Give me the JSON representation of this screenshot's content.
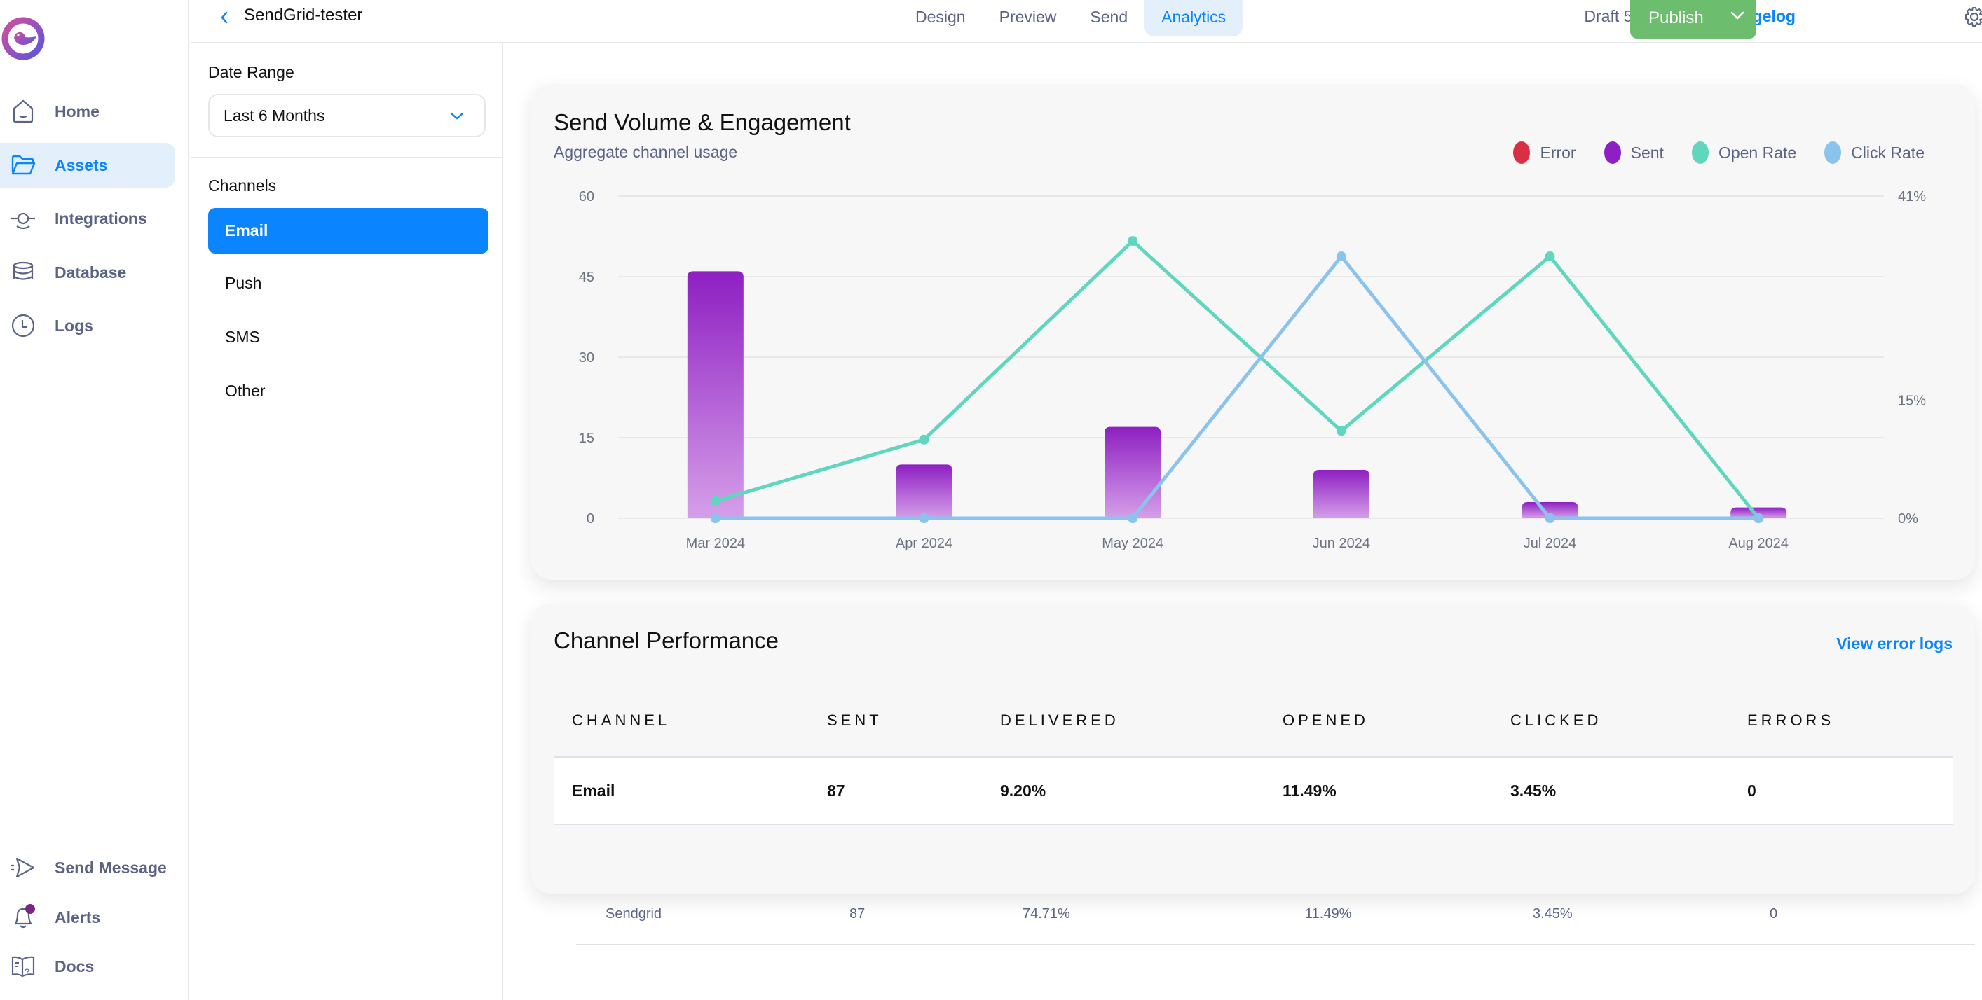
{
  "nav": {
    "logo": "courier-bird-logo",
    "items": [
      {
        "label": "Home",
        "icon": "home-icon",
        "active": false
      },
      {
        "label": "Assets",
        "icon": "folder-icon",
        "active": true
      },
      {
        "label": "Integrations",
        "icon": "integrations-icon",
        "active": false
      },
      {
        "label": "Database",
        "icon": "database-icon",
        "active": false
      },
      {
        "label": "Logs",
        "icon": "clock-icon",
        "active": false
      }
    ],
    "bottom_items": [
      {
        "label": "Send Message",
        "icon": "send-icon"
      },
      {
        "label": "Alerts",
        "icon": "bell-icon",
        "has_badge": true
      },
      {
        "label": "Docs",
        "icon": "docs-icon"
      }
    ]
  },
  "header": {
    "title": "SendGrid-tester",
    "tabs": [
      {
        "label": "Design",
        "active": false
      },
      {
        "label": "Preview",
        "active": false
      },
      {
        "label": "Send",
        "active": false
      },
      {
        "label": "Analytics",
        "active": true
      }
    ],
    "draft_status": "Draft 5 days ago",
    "separator": "|",
    "changelog_label": "Changelog",
    "publish_label": "Publish"
  },
  "panel": {
    "date_range_label": "Date Range",
    "date_range_value": "Last 6 Months",
    "channels_label": "Channels",
    "channels": [
      {
        "label": "Email",
        "active": true
      },
      {
        "label": "Push",
        "active": false
      },
      {
        "label": "SMS",
        "active": false
      },
      {
        "label": "Other",
        "active": false
      }
    ]
  },
  "colors": {
    "accent": "#0a84ff",
    "publish": "#6dbd6e",
    "error": "#d92f45",
    "sent": "#8e1fc2",
    "open_rate": "#5fd6bd",
    "click_rate": "#8ac4ed"
  },
  "chart_card": {
    "title": "Send Volume & Engagement",
    "subtitle": "Aggregate channel usage"
  },
  "chart_data": {
    "type": "bar",
    "title": "Send Volume & Engagement",
    "subtitle": "Aggregate channel usage",
    "categories": [
      "Mar 2024",
      "Apr 2024",
      "May 2024",
      "Jun 2024",
      "Jul 2024",
      "Aug 2024"
    ],
    "legend": [
      "Error",
      "Sent",
      "Open Rate",
      "Click Rate"
    ],
    "legend_position": "top-right",
    "series": [
      {
        "name": "Error",
        "type": "bar",
        "axis": "left",
        "values": [
          0,
          0,
          0,
          0,
          0,
          0
        ]
      },
      {
        "name": "Sent",
        "type": "bar",
        "axis": "left",
        "values": [
          46,
          10,
          17,
          9,
          3,
          2
        ]
      },
      {
        "name": "Open Rate",
        "type": "line",
        "axis": "right",
        "values": [
          2.17,
          10.0,
          35.29,
          11.11,
          33.33,
          0
        ]
      },
      {
        "name": "Click Rate",
        "type": "line",
        "axis": "right",
        "values": [
          0,
          0,
          0,
          33.33,
          0,
          0
        ]
      }
    ],
    "y_left": {
      "ylim": [
        0,
        60
      ],
      "ticks": [
        0,
        15,
        30,
        45,
        60
      ],
      "tick_labels": [
        "0",
        "15",
        "30",
        "45",
        "60"
      ]
    },
    "y_right": {
      "ylim": [
        0,
        41
      ],
      "ticks": [
        0,
        15,
        41
      ],
      "tick_labels": [
        "0%",
        "15%",
        "41%"
      ]
    },
    "grid": true,
    "xlabel": "",
    "ylabel": ""
  },
  "table_card": {
    "title": "Channel Performance",
    "view_logs_label": "View error logs",
    "columns": [
      "CHANNEL",
      "SENT",
      "DELIVERED",
      "OPENED",
      "CLICKED",
      "ERRORS"
    ],
    "rows": [
      {
        "type": "main",
        "cells": [
          "Email",
          "87",
          "9.20%",
          "11.49%",
          "3.45%",
          "0"
        ]
      },
      {
        "type": "sub",
        "cells": [
          "Sendgrid",
          "87",
          "74.71%",
          "11.49%",
          "3.45%",
          "0"
        ]
      }
    ]
  }
}
